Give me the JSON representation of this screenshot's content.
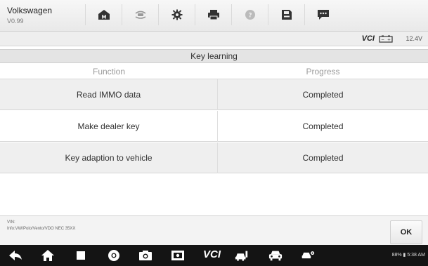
{
  "app": {
    "name": "Volkswagen",
    "version": "V0.99"
  },
  "toolbar": {
    "buttons": [
      {
        "icon": "home-m-icon"
      },
      {
        "icon": "vehicle-swap-icon"
      },
      {
        "icon": "settings-gear-icon"
      },
      {
        "icon": "printer-icon"
      },
      {
        "icon": "help-icon"
      },
      {
        "icon": "save-icon"
      },
      {
        "icon": "message-icon"
      }
    ]
  },
  "vci": {
    "logo_text": "VCI",
    "voltage": "12.4V"
  },
  "page": {
    "title": "Key learning"
  },
  "table": {
    "headers": {
      "function": "Function",
      "progress": "Progress"
    },
    "rows": [
      {
        "function": "Read IMMO data",
        "progress": "Completed"
      },
      {
        "function": "Make dealer key",
        "progress": "Completed"
      },
      {
        "function": "Key adaption to vehicle",
        "progress": "Completed"
      }
    ]
  },
  "info": {
    "vin_label": "VIN:",
    "details": "Info:VW/Polo/Vento/VDO NEC 35XX"
  },
  "actions": {
    "ok_label": "OK"
  },
  "navbar": {
    "vci_text": "VCI",
    "status_text": "88% ▮ 5:38 AM"
  },
  "colors": {
    "toolbar_bg": "#f0f0f0",
    "navbar_bg": "#141414",
    "title_bar_bg": "#e4e4e4",
    "row_shade": "#efefef"
  }
}
